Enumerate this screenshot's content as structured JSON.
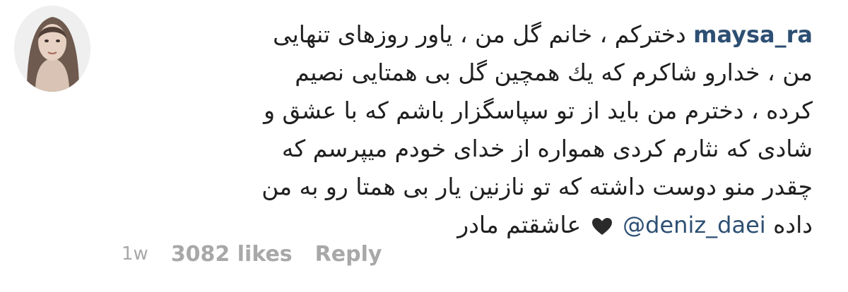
{
  "comment": {
    "username": "maysa_ra",
    "lines": [
      "دخترکم ، خانم گل من ، یاور روزهای تنهایی",
      "من ، خدارو شاکرم که یك همچین گل بی همتایی نصیم",
      "کرده ، دخترم من باید از تو سپاسگزار باشم که با عشق و",
      "شادی که نثارم کردی همواره از خدای خودم میپرسم که",
      "چقدر منو دوست داشته که تو نازنین یار بی همتا رو به من"
    ],
    "last_line_start": "عاشقتم مادر",
    "last_line_end": "داده",
    "mention": "@deniz_daei",
    "icons": {
      "avatar": "profile-avatar",
      "heart": "black-heart-icon"
    }
  },
  "meta": {
    "time": "1w",
    "likes": "3082 likes",
    "reply": "Reply"
  },
  "colors": {
    "username": "#2d4f73",
    "mention": "#2d4f73",
    "meta": "#a8a8a8",
    "text": "#1f1f1f"
  }
}
